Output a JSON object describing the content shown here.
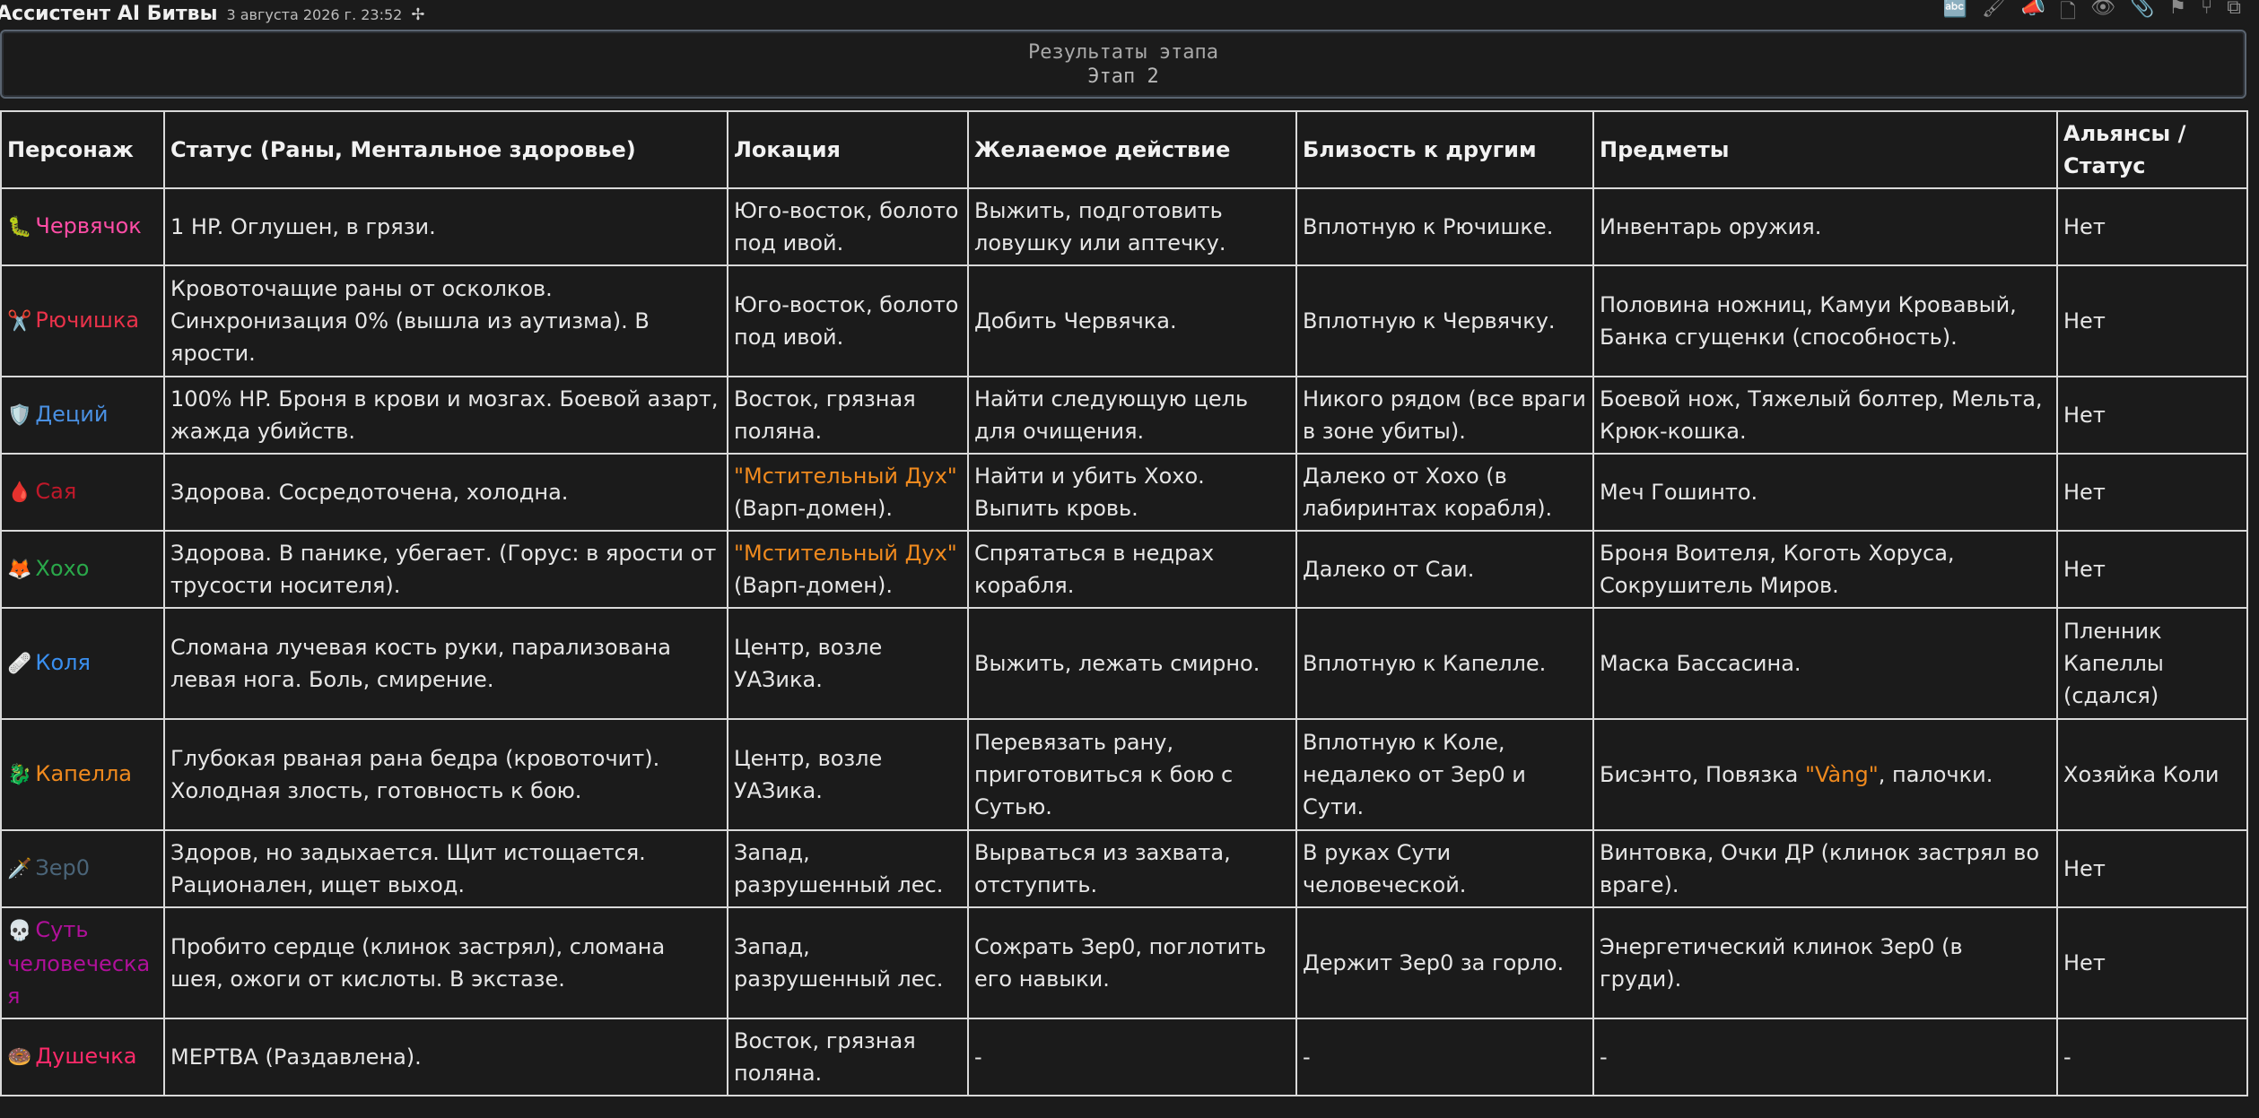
{
  "header": {
    "app_title": "Ассистент AI Битвы",
    "timestamp": "3 августа 2026 г. 23:52",
    "pin_icon": "pin-icon",
    "toolbar_icons": [
      "translate-icon",
      "brush-icon",
      "megaphone-icon",
      "document-icon",
      "eye-icon",
      "paperclip-icon",
      "flag-icon",
      "branch-icon",
      "copy-icon"
    ]
  },
  "stage": {
    "title": "Результаты этапа",
    "subtitle": "Этап 2"
  },
  "colors": {
    "pink": "#ff4da6",
    "red": "#e8324a",
    "blue": "#4a90e2",
    "darkred": "#c0182a",
    "green": "#2aa84a",
    "lightblue": "#3a8ff0",
    "orange": "#f08a1e",
    "slate": "#4a6478",
    "purple": "#b0109a",
    "magenta": "#ff2a6a"
  },
  "table": {
    "headers": [
      "Персонаж",
      "Статус (Раны, Ментальное здоровье)",
      "Локация",
      "Желаемое действие",
      "Близость к другим",
      "Предметы",
      "Альянсы / Статус"
    ],
    "rows": [
      {
        "emoji": "🐛",
        "name": "Червячок",
        "color": "#ff4da6",
        "status": "1 HP. Оглушен, в грязи.",
        "location": "Юго-восток, болото под ивой.",
        "action": "Выжить, подготовить ловушку или аптечку.",
        "proximity": "Вплотную к Рючишке.",
        "items": "Инвентарь оружия.",
        "alliance": "Нет"
      },
      {
        "emoji": "✂️",
        "name": "Рючишка",
        "color": "#e8324a",
        "status": "Кровоточащие раны от осколков. Синхронизация 0% (вышла из аутизма). В ярости.",
        "location": "Юго-восток, болото под ивой.",
        "action": "Добить Червячка.",
        "proximity": "Вплотную к Червячку.",
        "items": "Половина ножниц, Камуи Кровавый, Банка сгущенки (способность).",
        "alliance": "Нет"
      },
      {
        "emoji": "🛡️",
        "name": "Деций",
        "color": "#4a90e2",
        "status": "100% HP. Броня в крови и мозгах. Боевой азарт, жажда убийств.",
        "location": "Восток, грязная поляна.",
        "action": "Найти следующую цель для очищения.",
        "proximity": "Никого рядом (все враги в зоне убиты).",
        "items": "Боевой нож, Тяжелый болтер, Мельта, Крюк-кошка.",
        "alliance": "Нет"
      },
      {
        "emoji": "🩸",
        "name": "Сая",
        "color": "#c0182a",
        "status": "Здорова. Сосредоточена, холодна.",
        "location_accent": "\"Мстительный Дух\"",
        "location": "(Варп-домен).",
        "action": "Найти и убить Хохо. Выпить кровь.",
        "proximity": "Далеко от Хохо (в лабиринтах корабля).",
        "items": "Меч Гошинто.",
        "alliance": "Нет"
      },
      {
        "emoji": "🦊",
        "name": "Хохо",
        "color": "#2aa84a",
        "status": "Здорова. В панике, убегает. (Горус: в ярости от трусости носителя).",
        "location_accent": "\"Мстительный Дух\"",
        "location": "(Варп-домен).",
        "action": "Спрятаться в недрах корабля.",
        "proximity": "Далеко от Саи.",
        "items": "Броня Воителя, Коготь Хоруса, Сокрушитель Миров.",
        "alliance": "Нет"
      },
      {
        "emoji": "🩹",
        "name": "Коля",
        "color": "#3a8ff0",
        "status": "Сломана лучевая кость руки, парализована левая нога. Боль, смирение.",
        "location": "Центр, возле УАЗика.",
        "action": "Выжить, лежать смирно.",
        "proximity": "Вплотную к Капелле.",
        "items": "Маска Бассасина.",
        "alliance": "Пленник Капеллы (сдался)"
      },
      {
        "emoji": "🐉",
        "name": "Капелла",
        "color": "#f08a1e",
        "status": "Глубокая рваная рана бедра (кровоточит). Холодная злость, готовность к бою.",
        "location": "Центр, возле УАЗика.",
        "action": "Перевязать рану, приготовиться к бою с Сутью.",
        "proximity": "Вплотную к Коле, недалеко от Зер0 и Сути.",
        "items_pre": "Бисэнто, Повязка ",
        "items_accent": "\"Vàng\"",
        "items": ", палочки.",
        "alliance": "Хозяйка Коли"
      },
      {
        "emoji": "🗡️",
        "name": "Зер0",
        "color": "#4a6478",
        "status": "Здоров, но задыхается. Щит истощается. Рационален, ищет выход.",
        "location": "Запад, разрушенный лес.",
        "action": "Вырваться из захвата, отступить.",
        "proximity": "В руках Сути человеческой.",
        "items": "Винтовка, Очки ДР (клинок застрял во враге).",
        "alliance": "Нет"
      },
      {
        "emoji": "💀",
        "name": "Суть человеческа я",
        "color": "#b0109a",
        "status": "Пробито сердце (клинок застрял), сломана шея, ожоги от кислоты. В экстазе.",
        "location": "Запад, разрушенный лес.",
        "action": "Сожрать Зер0, поглотить его навыки.",
        "proximity": "Держит Зер0 за горло.",
        "items": "Энергетический клинок Зер0 (в груди).",
        "alliance": "Нет"
      },
      {
        "emoji": "🍩",
        "name": "Душечка",
        "color": "#ff2a6a",
        "status": "МЕРТВА (Раздавлена).",
        "location": "Восток, грязная поляна.",
        "action": "-",
        "proximity": "-",
        "items": "-",
        "alliance": "-"
      }
    ]
  }
}
